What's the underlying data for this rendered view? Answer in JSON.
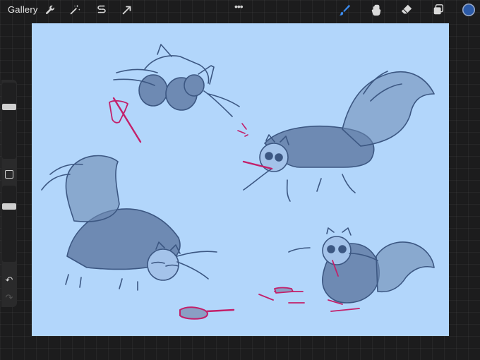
{
  "topbar": {
    "gallery_label": "Gallery",
    "more_label": "•••",
    "left_tools": [
      "wrench-icon",
      "magic-wand-icon",
      "selection-s-icon",
      "transform-arrow-icon"
    ],
    "right_tools": [
      "brush-icon",
      "smudge-icon",
      "eraser-icon",
      "layers-icon"
    ],
    "active_tool": "brush-icon",
    "active_color": "#2b5aa8"
  },
  "sidebar": {
    "brush_size_level": 0.3,
    "opacity_level": 0.25,
    "undo_label": "↶",
    "redo_label": "↷"
  },
  "canvas": {
    "background_color": "#b2d6fb",
    "sketch_colors": {
      "line": "#3c5782",
      "fill": "#6e8ab3",
      "accent": "#c3206a"
    }
  }
}
